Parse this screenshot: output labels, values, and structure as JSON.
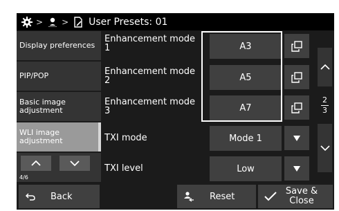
{
  "header": {
    "settings_icon": "gear-icon",
    "user_icon": "user-icon",
    "file_icon": "document-icon",
    "separator": ">",
    "title": "User Presets: 01"
  },
  "sidebar": {
    "items": [
      {
        "label": "Display preferences",
        "active": false
      },
      {
        "label": "PIP/POP",
        "active": false
      },
      {
        "label": "Basic image adjustment",
        "active": false
      },
      {
        "label": "WLI image adjustment",
        "active": true
      }
    ],
    "page_indicator": "4/6"
  },
  "rows": [
    {
      "label": "Enhancement mode 1",
      "value": "A3"
    },
    {
      "label": "Enhancement mode 2",
      "value": "A5"
    },
    {
      "label": "Enhancement mode 3",
      "value": "A7"
    },
    {
      "label": "TXI mode",
      "value": "Mode 1"
    },
    {
      "label": "TXI level",
      "value": "Low"
    }
  ],
  "pager": {
    "current": "2",
    "total": "3"
  },
  "footer": {
    "back_label": "Back",
    "reset_label": "Reset",
    "save_label": "Save & Close"
  },
  "colors": {
    "background": "#1b1b1b",
    "panel": "#404040",
    "active_sidebar": "#9a9a9a",
    "highlight": "#ffffff"
  }
}
